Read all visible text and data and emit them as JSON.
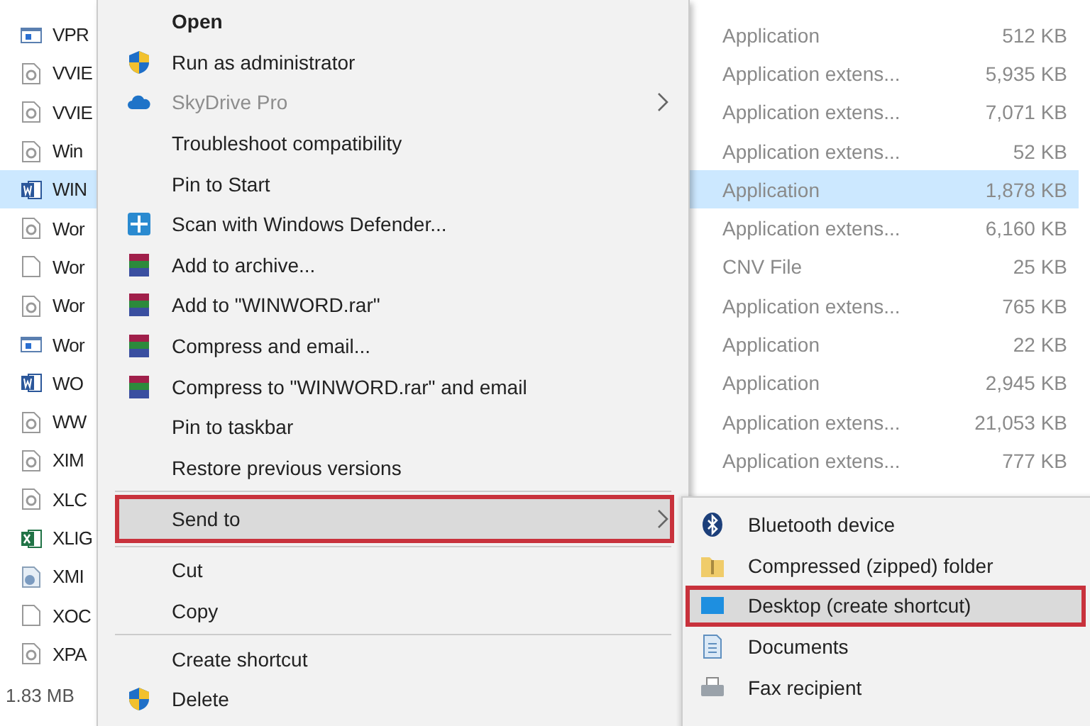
{
  "files": [
    {
      "name": "VPR",
      "kind": "app",
      "type": "Application",
      "size": "512 KB",
      "selected": false
    },
    {
      "name": "VVIE",
      "kind": "dll",
      "type": "Application extens...",
      "size": "5,935 KB",
      "selected": false
    },
    {
      "name": "VVIE",
      "kind": "dll",
      "type": "Application extens...",
      "size": "7,071 KB",
      "selected": false
    },
    {
      "name": "Win",
      "kind": "dll",
      "type": "Application extens...",
      "size": "52 KB",
      "selected": false
    },
    {
      "name": "WIN",
      "kind": "word",
      "type": "Application",
      "size": "1,878 KB",
      "selected": true
    },
    {
      "name": "Wor",
      "kind": "dll",
      "type": "Application extens...",
      "size": "6,160 KB",
      "selected": false
    },
    {
      "name": "Wor",
      "kind": "blank",
      "type": "CNV File",
      "size": "25 KB",
      "selected": false
    },
    {
      "name": "Wor",
      "kind": "dll",
      "type": "Application extens...",
      "size": "765 KB",
      "selected": false
    },
    {
      "name": "Wor",
      "kind": "app",
      "type": "Application",
      "size": "22 KB",
      "selected": false
    },
    {
      "name": "WO",
      "kind": "word",
      "type": "Application",
      "size": "2,945 KB",
      "selected": false
    },
    {
      "name": "WW",
      "kind": "dll",
      "type": "Application extens...",
      "size": "21,053 KB",
      "selected": false
    },
    {
      "name": "XIM",
      "kind": "dll",
      "type": "Application extens...",
      "size": "777 KB",
      "selected": false
    },
    {
      "name": "XLC",
      "kind": "dll",
      "selected": false
    },
    {
      "name": "XLIG",
      "kind": "excel",
      "selected": false
    },
    {
      "name": "XMI",
      "kind": "gear",
      "selected": false
    },
    {
      "name": "XOC",
      "kind": "blank",
      "selected": false
    },
    {
      "name": "XPA",
      "kind": "dll",
      "selected": false
    }
  ],
  "status_bar": "1.83 MB",
  "context_menu": [
    {
      "kind": "plain",
      "label": "Open",
      "bold": true,
      "disabled": false,
      "submenu": false,
      "selected": false
    },
    {
      "kind": "shield",
      "label": "Run as administrator",
      "bold": false,
      "disabled": false,
      "submenu": false,
      "selected": false
    },
    {
      "kind": "cloud",
      "label": "SkyDrive Pro",
      "bold": false,
      "disabled": true,
      "submenu": true,
      "selected": false
    },
    {
      "kind": "plain",
      "label": "Troubleshoot compatibility",
      "bold": false,
      "disabled": false,
      "submenu": false,
      "selected": false
    },
    {
      "kind": "plain",
      "label": "Pin to Start",
      "bold": false,
      "disabled": false,
      "submenu": false,
      "selected": false
    },
    {
      "kind": "defender",
      "label": "Scan with Windows Defender...",
      "bold": false,
      "disabled": false,
      "submenu": false,
      "selected": false
    },
    {
      "kind": "archive",
      "label": "Add to archive...",
      "bold": false,
      "disabled": false,
      "submenu": false,
      "selected": false
    },
    {
      "kind": "archive",
      "label": "Add to \"WINWORD.rar\"",
      "bold": false,
      "disabled": false,
      "submenu": false,
      "selected": false
    },
    {
      "kind": "archive",
      "label": "Compress and email...",
      "bold": false,
      "disabled": false,
      "submenu": false,
      "selected": false
    },
    {
      "kind": "archive",
      "label": "Compress to \"WINWORD.rar\" and email",
      "bold": false,
      "disabled": false,
      "submenu": false,
      "selected": false
    },
    {
      "kind": "plain",
      "label": "Pin to taskbar",
      "bold": false,
      "disabled": false,
      "submenu": false,
      "selected": false
    },
    {
      "kind": "plain",
      "label": "Restore previous versions",
      "bold": false,
      "disabled": false,
      "submenu": false,
      "selected": false
    },
    {
      "kind": "separator"
    },
    {
      "kind": "plain",
      "label": "Send to",
      "bold": false,
      "disabled": false,
      "submenu": true,
      "selected": true
    },
    {
      "kind": "separator"
    },
    {
      "kind": "plain",
      "label": "Cut",
      "bold": false,
      "disabled": false,
      "submenu": false,
      "selected": false
    },
    {
      "kind": "plain",
      "label": "Copy",
      "bold": false,
      "disabled": false,
      "submenu": false,
      "selected": false
    },
    {
      "kind": "separator"
    },
    {
      "kind": "plain",
      "label": "Create shortcut",
      "bold": false,
      "disabled": false,
      "submenu": false,
      "selected": false
    },
    {
      "kind": "shield",
      "label": "Delete",
      "bold": false,
      "disabled": false,
      "submenu": false,
      "selected": false
    }
  ],
  "send_to_menu": [
    {
      "label": "Bluetooth device",
      "kind": "bluetooth",
      "selected": false
    },
    {
      "label": "Compressed (zipped) folder",
      "kind": "zip",
      "selected": false
    },
    {
      "label": "Desktop (create shortcut)",
      "kind": "desktop",
      "selected": true
    },
    {
      "label": "Documents",
      "kind": "documents",
      "selected": false
    },
    {
      "label": "Fax recipient",
      "kind": "fax",
      "selected": false
    }
  ]
}
